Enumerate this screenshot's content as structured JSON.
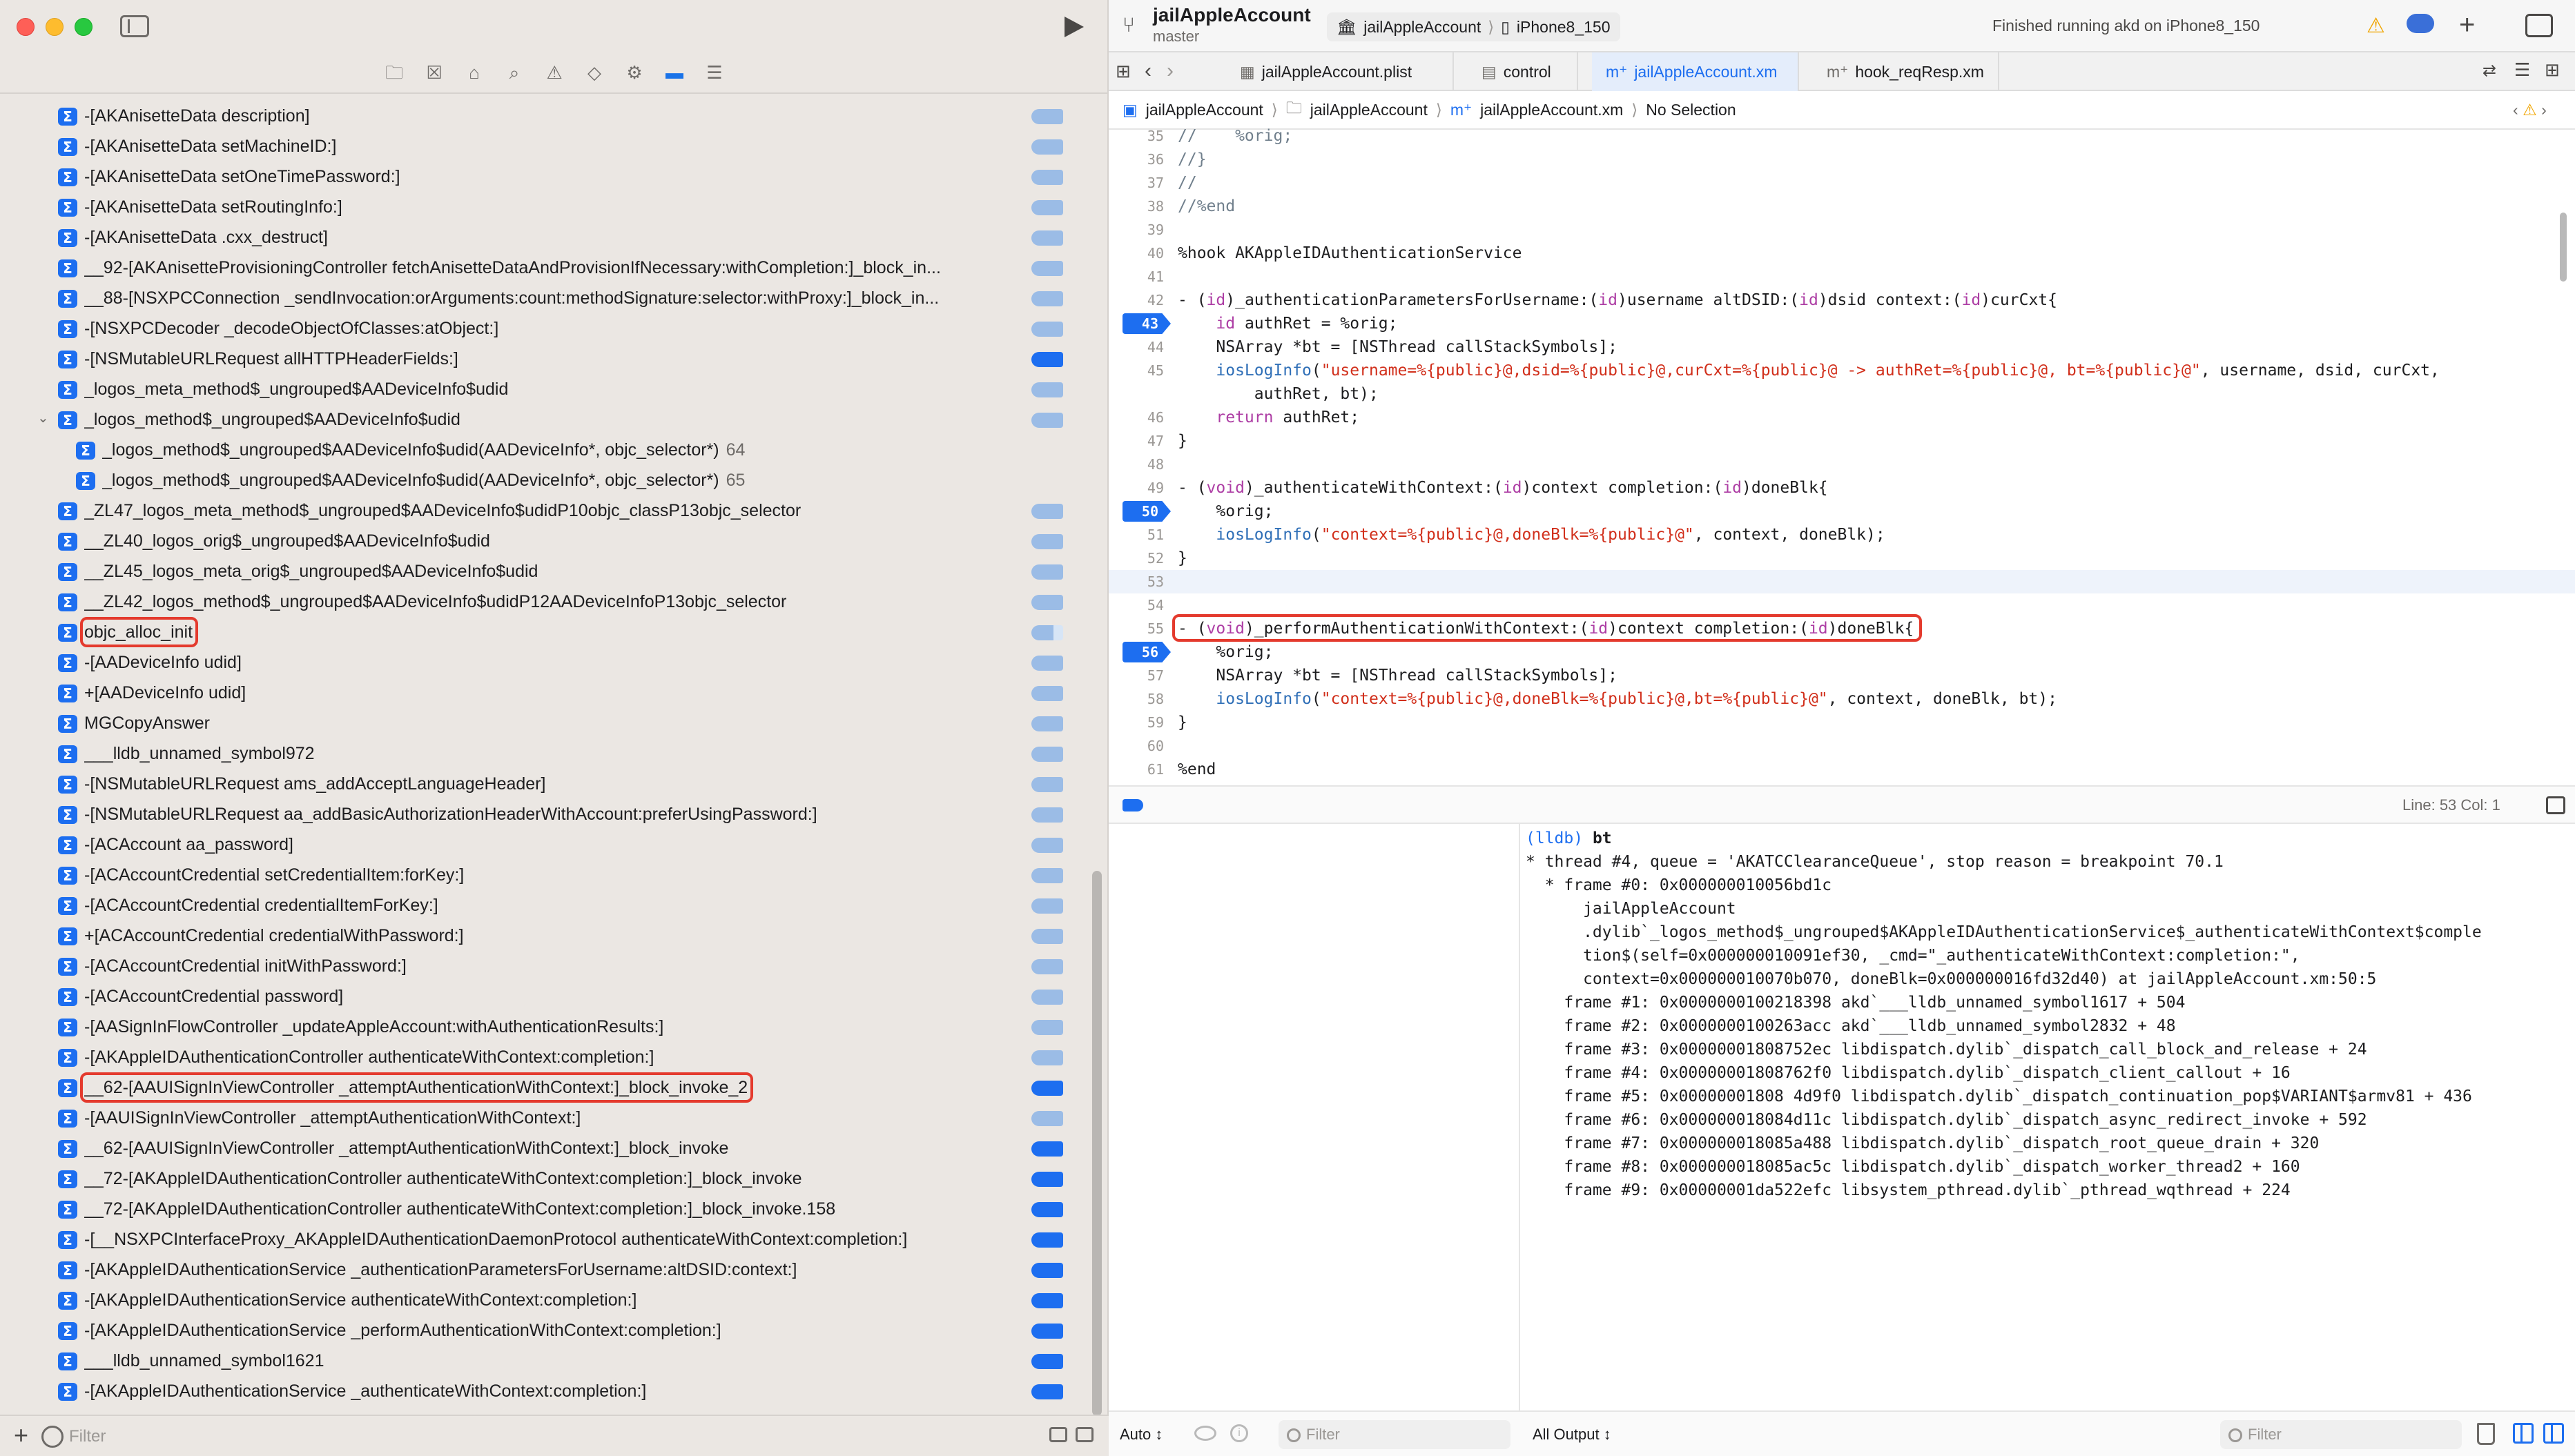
{
  "navigator": {
    "filter_placeholder": "Filter",
    "tab_icons": [
      "folder-icon",
      "source-control-icon",
      "symbol-icon",
      "find-icon",
      "issue-icon",
      "test-icon",
      "debug-icon",
      "breakpoint-icon",
      "report-icon"
    ],
    "symbols": [
      {
        "label": "-[AKAnisetteData description]",
        "badge": "light",
        "indent": 0
      },
      {
        "label": "-[AKAnisetteData setMachineID:]",
        "badge": "light",
        "indent": 0
      },
      {
        "label": "-[AKAnisetteData setOneTimePassword:]",
        "badge": "light",
        "indent": 0
      },
      {
        "label": "-[AKAnisetteData setRoutingInfo:]",
        "badge": "light",
        "indent": 0
      },
      {
        "label": "-[AKAnisetteData .cxx_destruct]",
        "badge": "light",
        "indent": 0
      },
      {
        "label": "__92-[AKAnisetteProvisioningController fetchAnisetteDataAndProvisionIfNecessary:withCompletion:]_block_in...",
        "badge": "light",
        "indent": 0
      },
      {
        "label": "__88-[NSXPCConnection _sendInvocation:orArguments:count:methodSignature:selector:withProxy:]_block_in...",
        "badge": "light",
        "indent": 0
      },
      {
        "label": "-[NSXPCDecoder _decodeObjectOfClasses:atObject:]",
        "badge": "light",
        "indent": 0
      },
      {
        "label": "-[NSMutableURLRequest allHTTPHeaderFields:]",
        "badge": "solid",
        "indent": 0
      },
      {
        "label": "_logos_meta_method$_ungrouped$AADeviceInfo$udid",
        "badge": "light",
        "indent": 0
      },
      {
        "label": "_logos_method$_ungrouped$AADeviceInfo$udid",
        "badge": "light",
        "indent": 0,
        "expanded": true
      },
      {
        "label": "_logos_method$_ungrouped$AADeviceInfo$udid(AADeviceInfo*, objc_selector*)",
        "count": "64",
        "badge": "none",
        "indent": 1
      },
      {
        "label": "_logos_method$_ungrouped$AADeviceInfo$udid(AADeviceInfo*, objc_selector*)",
        "count": "65",
        "badge": "none",
        "indent": 1
      },
      {
        "label": "_ZL47_logos_meta_method$_ungrouped$AADeviceInfo$udidP10objc_classP13objc_selector",
        "badge": "light",
        "indent": 0
      },
      {
        "label": "__ZL40_logos_orig$_ungrouped$AADeviceInfo$udid",
        "badge": "light",
        "indent": 0
      },
      {
        "label": "__ZL45_logos_meta_orig$_ungrouped$AADeviceInfo$udid",
        "badge": "light",
        "indent": 0
      },
      {
        "label": "__ZL42_logos_method$_ungrouped$AADeviceInfo$udidP12AADeviceInfoP13objc_selector",
        "badge": "light",
        "indent": 0
      },
      {
        "label": "objc_alloc_init",
        "badge": "half",
        "indent": 0,
        "highlight": true
      },
      {
        "label": "-[AADeviceInfo udid]",
        "badge": "light",
        "indent": 0
      },
      {
        "label": "+[AADeviceInfo udid]",
        "badge": "light",
        "indent": 0
      },
      {
        "label": "MGCopyAnswer",
        "badge": "light",
        "indent": 0
      },
      {
        "label": "___lldb_unnamed_symbol972",
        "badge": "light",
        "indent": 0
      },
      {
        "label": "-[NSMutableURLRequest ams_addAcceptLanguageHeader]",
        "badge": "light",
        "indent": 0
      },
      {
        "label": "-[NSMutableURLRequest aa_addBasicAuthorizationHeaderWithAccount:preferUsingPassword:]",
        "badge": "light",
        "indent": 0
      },
      {
        "label": "-[ACAccount aa_password]",
        "badge": "light",
        "indent": 0
      },
      {
        "label": "-[ACAccountCredential setCredentialItem:forKey:]",
        "badge": "light",
        "indent": 0
      },
      {
        "label": "-[ACAccountCredential credentialItemForKey:]",
        "badge": "light",
        "indent": 0
      },
      {
        "label": "+[ACAccountCredential credentialWithPassword:]",
        "badge": "light",
        "indent": 0
      },
      {
        "label": "-[ACAccountCredential initWithPassword:]",
        "badge": "light",
        "indent": 0
      },
      {
        "label": "-[ACAccountCredential password]",
        "badge": "light",
        "indent": 0
      },
      {
        "label": "-[AASignInFlowController _updateAppleAccount:withAuthenticationResults:]",
        "badge": "light",
        "indent": 0
      },
      {
        "label": "-[AKAppleIDAuthenticationController authenticateWithContext:completion:]",
        "badge": "light",
        "indent": 0
      },
      {
        "label": "__62-[AAUISignInViewController _attemptAuthenticationWithContext:]_block_invoke_2",
        "badge": "solid",
        "indent": 0,
        "highlight": true
      },
      {
        "label": "-[AAUISignInViewController _attemptAuthenticationWithContext:]",
        "badge": "light",
        "indent": 0
      },
      {
        "label": "__62-[AAUISignInViewController _attemptAuthenticationWithContext:]_block_invoke",
        "badge": "solid",
        "indent": 0
      },
      {
        "label": "__72-[AKAppleIDAuthenticationController authenticateWithContext:completion:]_block_invoke",
        "badge": "solid",
        "indent": 0
      },
      {
        "label": "__72-[AKAppleIDAuthenticationController authenticateWithContext:completion:]_block_invoke.158",
        "badge": "solid",
        "indent": 0
      },
      {
        "label": "-[__NSXPCInterfaceProxy_AKAppleIDAuthenticationDaemonProtocol authenticateWithContext:completion:]",
        "badge": "solid",
        "indent": 0
      },
      {
        "label": "-[AKAppleIDAuthenticationService _authenticationParametersForUsername:altDSID:context:]",
        "badge": "solid",
        "indent": 0
      },
      {
        "label": "-[AKAppleIDAuthenticationService authenticateWithContext:completion:]",
        "badge": "solid",
        "indent": 0
      },
      {
        "label": "-[AKAppleIDAuthenticationService _performAuthenticationWithContext:completion:]",
        "badge": "solid",
        "indent": 0
      },
      {
        "label": "___lldb_unnamed_symbol1621",
        "badge": "solid",
        "indent": 0
      },
      {
        "label": "-[AKAppleIDAuthenticationService _authenticateWithContext:completion:]",
        "badge": "solid",
        "indent": 0
      }
    ]
  },
  "toolbar": {
    "project": "jailAppleAccount",
    "branch": "master",
    "scheme": "jailAppleAccount",
    "device": "iPhone8_150",
    "status": "Finished running akd on iPhone8_150"
  },
  "tabs": [
    {
      "label": "jailAppleAccount.plist",
      "icon": "plist-icon"
    },
    {
      "label": "control",
      "icon": "file-icon"
    },
    {
      "label": "jailAppleAccount.xm",
      "icon": "mm-file-icon",
      "active": true
    },
    {
      "label": "hook_reqResp.xm",
      "icon": "mm-file-icon"
    }
  ],
  "breadcrumb": [
    "jailAppleAccount",
    "jailAppleAccount",
    "jailAppleAccount.xm",
    "No Selection"
  ],
  "code": [
    {
      "n": "35",
      "html": "<span class=\"cmt\">//    %orig;</span>"
    },
    {
      "n": "36",
      "html": "<span class=\"cmt\">//}</span>"
    },
    {
      "n": "37",
      "html": "<span class=\"cmt\">//</span>"
    },
    {
      "n": "38",
      "html": "<span class=\"cmt\">//%end</span>"
    },
    {
      "n": "39",
      "html": ""
    },
    {
      "n": "40",
      "html": "%hook AKAppleIDAuthenticationService"
    },
    {
      "n": "41",
      "html": ""
    },
    {
      "n": "42",
      "html": "- (<span class=\"kw\">id</span>)_authenticationParametersForUsername:(<span class=\"kw\">id</span>)username altDSID:(<span class=\"kw\">id</span>)dsid context:(<span class=\"kw\">id</span>)curCxt{"
    },
    {
      "n": "43",
      "bp": true,
      "html": "    <span class=\"kw\">id</span> authRet = %orig;"
    },
    {
      "n": "44",
      "html": "    NSArray *bt = [NSThread callStackSymbols];"
    },
    {
      "n": "45",
      "html": "    <span class=\"fn\">iosLogInfo</span>(<span class=\"str\">\"username=%{public}@,dsid=%{public}@,curCxt=%{public}@ -> authRet=%{public}@, bt=%{public}@\"</span>, username, dsid, curCxt,"
    },
    {
      "n": "",
      "html": "        authRet, bt);"
    },
    {
      "n": "46",
      "html": "    <span class=\"kw\">return</span> authRet;"
    },
    {
      "n": "47",
      "html": "}"
    },
    {
      "n": "48",
      "html": ""
    },
    {
      "n": "49",
      "html": "- (<span class=\"kw\">void</span>)_authenticateWithContext:(<span class=\"kw\">id</span>)context completion:(<span class=\"kw\">id</span>)doneBlk{"
    },
    {
      "n": "50",
      "bp": true,
      "html": "    %orig;"
    },
    {
      "n": "51",
      "html": "    <span class=\"fn\">iosLogInfo</span>(<span class=\"str\">\"context=%{public}@,doneBlk=%{public}@\"</span>, context, doneBlk);"
    },
    {
      "n": "52",
      "html": "}"
    },
    {
      "n": "53",
      "cur": true,
      "html": ""
    },
    {
      "n": "54",
      "html": ""
    },
    {
      "n": "55",
      "hl": true,
      "html": "- (<span class=\"kw\">void</span>)_performAuthenticationWithContext:(<span class=\"kw\">id</span>)context completion:(<span class=\"kw\">id</span>)doneBlk{"
    },
    {
      "n": "56",
      "bp": true,
      "html": "    %orig;"
    },
    {
      "n": "57",
      "html": "    NSArray *bt = [NSThread callStackSymbols];"
    },
    {
      "n": "58",
      "html": "    <span class=\"fn\">iosLogInfo</span>(<span class=\"str\">\"context=%{public}@,doneBlk=%{public}@,bt=%{public}@\"</span>, context, doneBlk, bt);"
    },
    {
      "n": "59",
      "html": "}"
    },
    {
      "n": "60",
      "html": ""
    },
    {
      "n": "61",
      "html": "%end"
    }
  ],
  "editor_status": {
    "position": "Line: 53  Col: 1"
  },
  "console": {
    "lines": [
      {
        "prompt": "(lldb)",
        "text": " bt"
      },
      {
        "text": "* thread #4, queue = 'AKATCClearanceQueue', stop reason = breakpoint 70.1"
      },
      {
        "text": "  * frame #0: 0x000000010056bd1c"
      },
      {
        "text": "      jailAppleAccount"
      },
      {
        "text": "      .dylib`_logos_method$_ungrouped$AKAppleIDAuthenticationService$_authenticateWithContext$comple"
      },
      {
        "text": "      tion$(self=0x000000010091ef30, _cmd=\"_authenticateWithContext:completion:\","
      },
      {
        "text": "      context=0x000000010070b070, doneBlk=0x000000016fd32d40) at jailAppleAccount.xm:50:5"
      },
      {
        "text": "    frame #1: 0x0000000100218398 akd`___lldb_unnamed_symbol1617 + 504"
      },
      {
        "text": "    frame #2: 0x0000000100263acc akd`___lldb_unnamed_symbol2832 + 48"
      },
      {
        "text": "    frame #3: 0x00000001808752ec libdispatch.dylib`_dispatch_call_block_and_release + 24"
      },
      {
        "text": "    frame #4: 0x00000001808762f0 libdispatch.dylib`_dispatch_client_callout + 16"
      },
      {
        "text": "    frame #5: 0x00000001808 4d9f0 libdispatch.dylib`_dispatch_continuation_pop$VARIANT$armv81 + 436"
      },
      {
        "text": "    frame #6: 0x000000018084d11c libdispatch.dylib`_dispatch_async_redirect_invoke + 592"
      },
      {
        "text": "    frame #7: 0x000000018085a488 libdispatch.dylib`_dispatch_root_queue_drain + 320"
      },
      {
        "text": "    frame #8: 0x000000018085ac5c libdispatch.dylib`_dispatch_worker_thread2 + 160"
      },
      {
        "text": "    frame #9: 0x00000001da522efc libsystem_pthread.dylib`_pthread_wqthread + 224"
      }
    ]
  },
  "debug_bar": {
    "auto_label": "Auto ↕",
    "var_filter": "Filter",
    "output_label": "All Output ↕",
    "con_filter": "Filter"
  }
}
